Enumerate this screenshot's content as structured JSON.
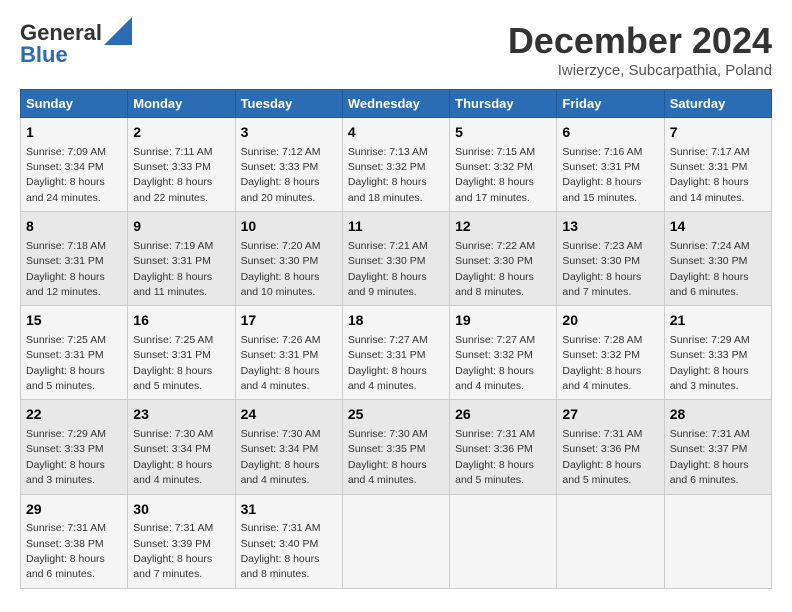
{
  "logo": {
    "line1": "General",
    "line2": "Blue"
  },
  "header": {
    "month": "December 2024",
    "location": "Iwierzyce, Subcarpathia, Poland"
  },
  "columns": [
    "Sunday",
    "Monday",
    "Tuesday",
    "Wednesday",
    "Thursday",
    "Friday",
    "Saturday"
  ],
  "weeks": [
    [
      {
        "day": "1",
        "sunrise": "7:09 AM",
        "sunset": "3:34 PM",
        "daylight": "8 hours and 24 minutes."
      },
      {
        "day": "2",
        "sunrise": "7:11 AM",
        "sunset": "3:33 PM",
        "daylight": "8 hours and 22 minutes."
      },
      {
        "day": "3",
        "sunrise": "7:12 AM",
        "sunset": "3:33 PM",
        "daylight": "8 hours and 20 minutes."
      },
      {
        "day": "4",
        "sunrise": "7:13 AM",
        "sunset": "3:32 PM",
        "daylight": "8 hours and 18 minutes."
      },
      {
        "day": "5",
        "sunrise": "7:15 AM",
        "sunset": "3:32 PM",
        "daylight": "8 hours and 17 minutes."
      },
      {
        "day": "6",
        "sunrise": "7:16 AM",
        "sunset": "3:31 PM",
        "daylight": "8 hours and 15 minutes."
      },
      {
        "day": "7",
        "sunrise": "7:17 AM",
        "sunset": "3:31 PM",
        "daylight": "8 hours and 14 minutes."
      }
    ],
    [
      {
        "day": "8",
        "sunrise": "7:18 AM",
        "sunset": "3:31 PM",
        "daylight": "8 hours and 12 minutes."
      },
      {
        "day": "9",
        "sunrise": "7:19 AM",
        "sunset": "3:31 PM",
        "daylight": "8 hours and 11 minutes."
      },
      {
        "day": "10",
        "sunrise": "7:20 AM",
        "sunset": "3:30 PM",
        "daylight": "8 hours and 10 minutes."
      },
      {
        "day": "11",
        "sunrise": "7:21 AM",
        "sunset": "3:30 PM",
        "daylight": "8 hours and 9 minutes."
      },
      {
        "day": "12",
        "sunrise": "7:22 AM",
        "sunset": "3:30 PM",
        "daylight": "8 hours and 8 minutes."
      },
      {
        "day": "13",
        "sunrise": "7:23 AM",
        "sunset": "3:30 PM",
        "daylight": "8 hours and 7 minutes."
      },
      {
        "day": "14",
        "sunrise": "7:24 AM",
        "sunset": "3:30 PM",
        "daylight": "8 hours and 6 minutes."
      }
    ],
    [
      {
        "day": "15",
        "sunrise": "7:25 AM",
        "sunset": "3:31 PM",
        "daylight": "8 hours and 5 minutes."
      },
      {
        "day": "16",
        "sunrise": "7:25 AM",
        "sunset": "3:31 PM",
        "daylight": "8 hours and 5 minutes."
      },
      {
        "day": "17",
        "sunrise": "7:26 AM",
        "sunset": "3:31 PM",
        "daylight": "8 hours and 4 minutes."
      },
      {
        "day": "18",
        "sunrise": "7:27 AM",
        "sunset": "3:31 PM",
        "daylight": "8 hours and 4 minutes."
      },
      {
        "day": "19",
        "sunrise": "7:27 AM",
        "sunset": "3:32 PM",
        "daylight": "8 hours and 4 minutes."
      },
      {
        "day": "20",
        "sunrise": "7:28 AM",
        "sunset": "3:32 PM",
        "daylight": "8 hours and 4 minutes."
      },
      {
        "day": "21",
        "sunrise": "7:29 AM",
        "sunset": "3:33 PM",
        "daylight": "8 hours and 3 minutes."
      }
    ],
    [
      {
        "day": "22",
        "sunrise": "7:29 AM",
        "sunset": "3:33 PM",
        "daylight": "8 hours and 3 minutes."
      },
      {
        "day": "23",
        "sunrise": "7:30 AM",
        "sunset": "3:34 PM",
        "daylight": "8 hours and 4 minutes."
      },
      {
        "day": "24",
        "sunrise": "7:30 AM",
        "sunset": "3:34 PM",
        "daylight": "8 hours and 4 minutes."
      },
      {
        "day": "25",
        "sunrise": "7:30 AM",
        "sunset": "3:35 PM",
        "daylight": "8 hours and 4 minutes."
      },
      {
        "day": "26",
        "sunrise": "7:31 AM",
        "sunset": "3:36 PM",
        "daylight": "8 hours and 5 minutes."
      },
      {
        "day": "27",
        "sunrise": "7:31 AM",
        "sunset": "3:36 PM",
        "daylight": "8 hours and 5 minutes."
      },
      {
        "day": "28",
        "sunrise": "7:31 AM",
        "sunset": "3:37 PM",
        "daylight": "8 hours and 6 minutes."
      }
    ],
    [
      {
        "day": "29",
        "sunrise": "7:31 AM",
        "sunset": "3:38 PM",
        "daylight": "8 hours and 6 minutes."
      },
      {
        "day": "30",
        "sunrise": "7:31 AM",
        "sunset": "3:39 PM",
        "daylight": "8 hours and 7 minutes."
      },
      {
        "day": "31",
        "sunrise": "7:31 AM",
        "sunset": "3:40 PM",
        "daylight": "8 hours and 8 minutes."
      },
      null,
      null,
      null,
      null
    ]
  ],
  "labels": {
    "sunrise": "Sunrise:",
    "sunset": "Sunset:",
    "daylight": "Daylight:"
  }
}
